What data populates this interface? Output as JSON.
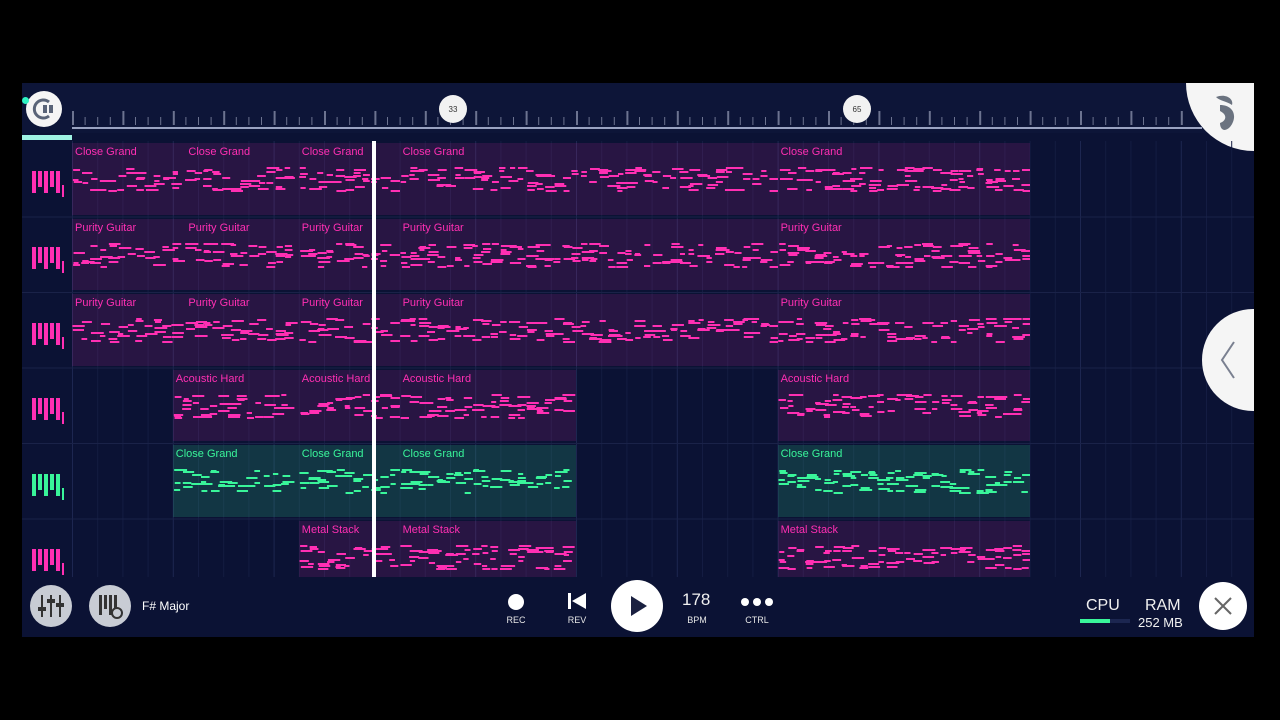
{
  "timeline": {
    "markers": [
      "33",
      "65"
    ]
  },
  "tracks": [
    {
      "color": "#ff2fb3",
      "icon": "piano-keys-icon",
      "patterns": [
        {
          "label": "Close Grand",
          "start": 1,
          "end": 10
        },
        {
          "label": "Close Grand",
          "start": 10,
          "end": 19
        },
        {
          "label": "Close Grand",
          "start": 19,
          "end": 27
        },
        {
          "label": "Close Grand",
          "start": 27,
          "end": 57
        },
        {
          "label": "Close Grand",
          "start": 57,
          "end": 77
        }
      ]
    },
    {
      "color": "#ff2fb3",
      "icon": "piano-keys-icon",
      "patterns": [
        {
          "label": "Purity Guitar",
          "start": 1,
          "end": 10
        },
        {
          "label": "Purity Guitar",
          "start": 10,
          "end": 19
        },
        {
          "label": "Purity Guitar",
          "start": 19,
          "end": 27
        },
        {
          "label": "Purity Guitar",
          "start": 27,
          "end": 57
        },
        {
          "label": "Purity Guitar",
          "start": 57,
          "end": 77
        }
      ]
    },
    {
      "color": "#ff2fb3",
      "icon": "piano-keys-icon",
      "patterns": [
        {
          "label": "Purity Guitar",
          "start": 1,
          "end": 10
        },
        {
          "label": "Purity Guitar",
          "start": 10,
          "end": 19
        },
        {
          "label": "Purity Guitar",
          "start": 19,
          "end": 27
        },
        {
          "label": "Purity Guitar",
          "start": 27,
          "end": 57
        },
        {
          "label": "Purity Guitar",
          "start": 57,
          "end": 77
        }
      ]
    },
    {
      "color": "#ff2fb3",
      "icon": "piano-keys-icon",
      "patterns": [
        {
          "label": "Acoustic Hard",
          "start": 9,
          "end": 19
        },
        {
          "label": "Acoustic Hard",
          "start": 19,
          "end": 27
        },
        {
          "label": "Acoustic Hard",
          "start": 27,
          "end": 41
        },
        {
          "label": "Acoustic Hard",
          "start": 57,
          "end": 77
        }
      ]
    },
    {
      "color": "#39f59a",
      "icon": "piano-keys-icon",
      "patterns": [
        {
          "label": "Close Grand",
          "start": 9,
          "end": 19
        },
        {
          "label": "Close Grand",
          "start": 19,
          "end": 27
        },
        {
          "label": "Close Grand",
          "start": 27,
          "end": 41
        },
        {
          "label": "Close Grand",
          "start": 57,
          "end": 77
        }
      ]
    },
    {
      "color": "#ff2fb3",
      "icon": "piano-keys-icon",
      "patterns": [
        {
          "label": "Metal Stack",
          "start": 19,
          "end": 27
        },
        {
          "label": "Metal Stack",
          "start": 27,
          "end": 41
        },
        {
          "label": "Metal Stack",
          "start": 57,
          "end": 77
        }
      ]
    }
  ],
  "playhead_bar": 25,
  "transport": {
    "scale": "F# Major",
    "rec_label": "REC",
    "rev_label": "REV",
    "tempo": "178",
    "bpm_label": "BPM",
    "ctrl_label": "CTRL",
    "cpu_label": "CPU",
    "ram_label": "RAM",
    "ram_value": "252 MB",
    "cpu_level": 0.6
  },
  "colors": {
    "background": "#0b1234",
    "accent_pink": "#ff2fb3",
    "accent_green": "#39f59a",
    "loop_teal": "#2ff3c3"
  }
}
